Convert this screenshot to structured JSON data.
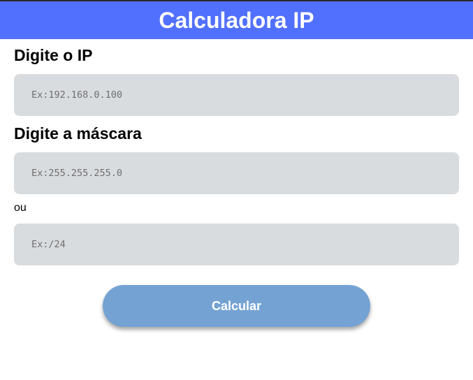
{
  "header": {
    "title": "Calculadora IP"
  },
  "form": {
    "ip_label": "Digite o IP",
    "ip_placeholder": "Ex:192.168.0.100",
    "mask_label": "Digite a máscara",
    "mask_placeholder": "Ex:255.255.255.0",
    "or_label": "ou",
    "cidr_placeholder": "Ex:/24",
    "calculate_label": "Calcular"
  },
  "colors": {
    "header_bg": "#5270fe",
    "field_bg": "#d9dcdf",
    "button_bg": "#74a3d3"
  }
}
